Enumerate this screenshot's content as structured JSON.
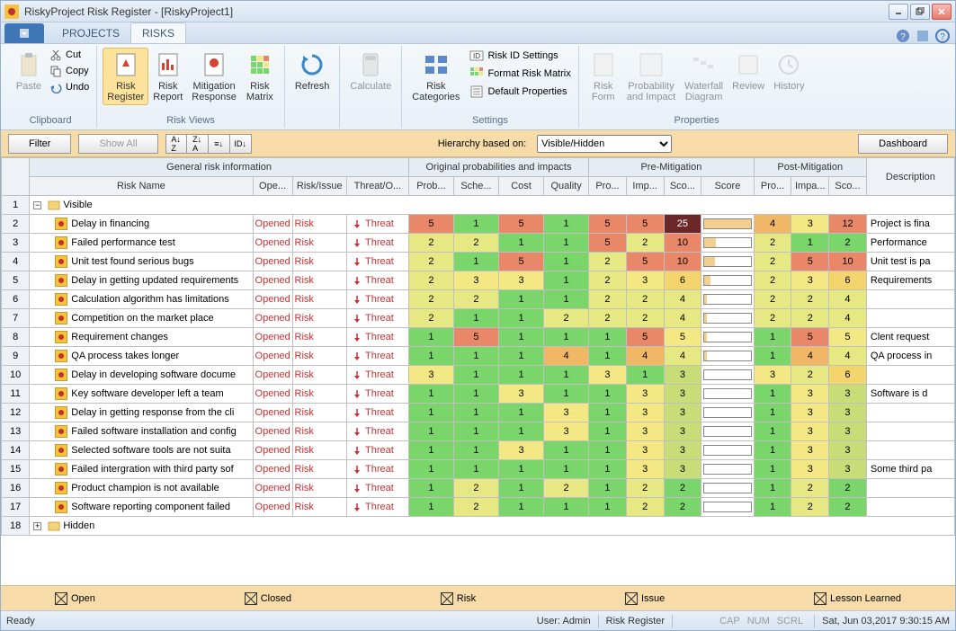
{
  "title": "RiskyProject Risk Register - [RiskyProject1]",
  "tabs": {
    "projects": "PROJECTS",
    "risks": "RISKS"
  },
  "ribbon": {
    "clipboard": {
      "label": "Clipboard",
      "paste": "Paste",
      "cut": "Cut",
      "copy": "Copy",
      "undo": "Undo"
    },
    "riskviews": {
      "label": "Risk Views",
      "register": "Risk\nRegister",
      "report": "Risk\nReport",
      "mitigation": "Mitigation\nResponse",
      "matrix": "Risk\nMatrix"
    },
    "refresh": "Refresh",
    "calculate": "Calculate",
    "categories": "Risk\nCategories",
    "settings": {
      "label": "Settings",
      "id": "Risk ID Settings",
      "format": "Format Risk Matrix",
      "default": "Default Properties"
    },
    "properties": {
      "label": "Properties",
      "form": "Risk\nForm",
      "prob": "Probability\nand Impact",
      "waterfall": "Waterfall\nDiagram",
      "review": "Review",
      "history": "History"
    }
  },
  "filterbar": {
    "filter": "Filter",
    "showall": "Show All",
    "hierarchy": "Hierarchy based on:",
    "hierval": "Visible/Hidden",
    "dashboard": "Dashboard"
  },
  "columns": {
    "groups": {
      "general": "General risk information",
      "orig": "Original probabilities and impacts",
      "pre": "Pre-Mitigation",
      "post": "Post-Mitigation"
    },
    "name": "Risk Name",
    "open": "Ope...",
    "riskissue": "Risk/Issue",
    "threat": "Threat/O...",
    "prob": "Prob...",
    "sche": "Sche...",
    "cost": "Cost",
    "quality": "Quality",
    "pro2": "Pro...",
    "imp": "Imp...",
    "sco": "Sco...",
    "score": "Score",
    "pro3": "Pro...",
    "impa": "Impa...",
    "sco2": "Sco...",
    "desc": "Description"
  },
  "groupRows": {
    "visible": "Visible",
    "hidden": "Hidden"
  },
  "rows": [
    {
      "n": 2,
      "name": "Delay in financing",
      "open": "Opened",
      "ri": "Risk",
      "threat": "Threat",
      "orig": [
        5,
        1,
        5,
        1
      ],
      "pre": [
        5,
        5,
        25
      ],
      "scorebar": 100,
      "post": [
        4,
        3,
        12
      ],
      "desc": "Project is fina"
    },
    {
      "n": 3,
      "name": "Failed performance test",
      "open": "Opened",
      "ri": "Risk",
      "threat": "Threat",
      "orig": [
        2,
        2,
        1,
        1
      ],
      "pre": [
        5,
        2,
        10
      ],
      "scorebar": 24,
      "post": [
        2,
        1,
        2
      ],
      "desc": "Performance "
    },
    {
      "n": 4,
      "name": "Unit test found serious bugs",
      "open": "Opened",
      "ri": "Risk",
      "threat": "Threat",
      "orig": [
        2,
        1,
        5,
        1
      ],
      "pre": [
        2,
        5,
        10
      ],
      "scorebar": 22,
      "post": [
        2,
        5,
        10
      ],
      "desc": "Unit test is pa"
    },
    {
      "n": 5,
      "name": "Delay in getting updated requirements",
      "open": "Opened",
      "ri": "Risk",
      "threat": "Threat",
      "orig": [
        2,
        3,
        3,
        1
      ],
      "pre": [
        2,
        3,
        6
      ],
      "scorebar": 14,
      "post": [
        2,
        3,
        6
      ],
      "desc": "Requirements"
    },
    {
      "n": 6,
      "name": "Calculation algorithm has limitations",
      "open": "Opened",
      "ri": "Risk",
      "threat": "Threat",
      "orig": [
        2,
        2,
        1,
        1
      ],
      "pre": [
        2,
        2,
        4
      ],
      "scorebar": 6,
      "post": [
        2,
        2,
        4
      ],
      "desc": ""
    },
    {
      "n": 7,
      "name": "Competition on the market place",
      "open": "Opened",
      "ri": "Risk",
      "threat": "Threat",
      "orig": [
        2,
        1,
        1,
        2
      ],
      "pre": [
        2,
        2,
        4
      ],
      "scorebar": 6,
      "post": [
        2,
        2,
        4
      ],
      "desc": ""
    },
    {
      "n": 8,
      "name": "Requirement changes",
      "open": "Opened",
      "ri": "Risk",
      "threat": "Threat",
      "orig": [
        1,
        5,
        1,
        1
      ],
      "pre": [
        1,
        5,
        5
      ],
      "scorebar": 6,
      "post": [
        1,
        5,
        5
      ],
      "desc": "Clent request"
    },
    {
      "n": 9,
      "name": "QA process takes longer",
      "open": "Opened",
      "ri": "Risk",
      "threat": "Threat",
      "orig": [
        1,
        1,
        1,
        4
      ],
      "pre": [
        1,
        4,
        4
      ],
      "scorebar": 5,
      "post": [
        1,
        4,
        4
      ],
      "desc": "QA process in"
    },
    {
      "n": 10,
      "name": "Delay in developing software docume",
      "open": "Opened",
      "ri": "Risk",
      "threat": "Threat",
      "orig": [
        3,
        1,
        1,
        1
      ],
      "pre": [
        3,
        1,
        3
      ],
      "scorebar": 0,
      "post": [
        3,
        2,
        6
      ],
      "desc": ""
    },
    {
      "n": 11,
      "name": "Key software developer left a team",
      "open": "Opened",
      "ri": "Risk",
      "threat": "Threat",
      "orig": [
        1,
        1,
        3,
        1
      ],
      "pre": [
        1,
        3,
        3
      ],
      "scorebar": 0,
      "post": [
        1,
        3,
        3
      ],
      "desc": "Software is d"
    },
    {
      "n": 12,
      "name": "Delay in getting response from the cli",
      "open": "Opened",
      "ri": "Risk",
      "threat": "Threat",
      "orig": [
        1,
        1,
        1,
        3
      ],
      "pre": [
        1,
        3,
        3
      ],
      "scorebar": 0,
      "post": [
        1,
        3,
        3
      ],
      "desc": ""
    },
    {
      "n": 13,
      "name": "Failed software installation and config",
      "open": "Opened",
      "ri": "Risk",
      "threat": "Threat",
      "orig": [
        1,
        1,
        1,
        3
      ],
      "pre": [
        1,
        3,
        3
      ],
      "scorebar": 0,
      "post": [
        1,
        3,
        3
      ],
      "desc": ""
    },
    {
      "n": 14,
      "name": "Selected software tools are not suita",
      "open": "Opened",
      "ri": "Risk",
      "threat": "Threat",
      "orig": [
        1,
        1,
        3,
        1
      ],
      "pre": [
        1,
        3,
        3
      ],
      "scorebar": 0,
      "post": [
        1,
        3,
        3
      ],
      "desc": ""
    },
    {
      "n": 15,
      "name": "Failed intergration with third party sof",
      "open": "Opened",
      "ri": "Risk",
      "threat": "Threat",
      "orig": [
        1,
        1,
        1,
        1
      ],
      "pre": [
        1,
        3,
        3
      ],
      "scorebar": 0,
      "post": [
        1,
        3,
        3
      ],
      "desc": "Some third pa"
    },
    {
      "n": 16,
      "name": "Product champion is not available",
      "open": "Opened",
      "ri": "Risk",
      "threat": "Threat",
      "orig": [
        1,
        2,
        1,
        2
      ],
      "pre": [
        1,
        2,
        2
      ],
      "scorebar": 0,
      "post": [
        1,
        2,
        2
      ],
      "desc": ""
    },
    {
      "n": 17,
      "name": "Software reporting component failed",
      "open": "Opened",
      "ri": "Risk",
      "threat": "Threat",
      "orig": [
        1,
        2,
        1,
        1
      ],
      "pre": [
        1,
        2,
        2
      ],
      "scorebar": 0,
      "post": [
        1,
        2,
        2
      ],
      "desc": ""
    }
  ],
  "legend": {
    "open": "Open",
    "closed": "Closed",
    "risk": "Risk",
    "issue": "Issue",
    "lesson": "Lesson Learned"
  },
  "status": {
    "ready": "Ready",
    "user": "User: Admin",
    "section": "Risk Register",
    "cap": "CAP",
    "num": "NUM",
    "scrl": "SCRL",
    "date": "Sat, Jun 03,2017  9:30:15 AM"
  }
}
